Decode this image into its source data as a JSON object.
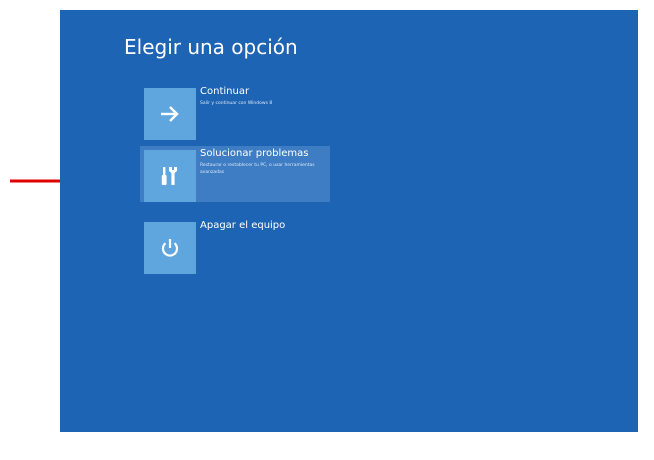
{
  "screen": {
    "title": "Elegir una opción",
    "background_color": "#1e64b4",
    "tile_color": "#5fa6df"
  },
  "options": [
    {
      "label": "Continuar",
      "description": "Salir y continuar con Windows 8",
      "icon": "arrow-right-icon"
    },
    {
      "label": "Solucionar problemas",
      "description": "Restaurar o restablecer tu PC, o usar herramientas avanzadas",
      "icon": "tools-icon",
      "highlighted": true
    },
    {
      "label": "Apagar el equipo",
      "description": "",
      "icon": "power-icon"
    }
  ],
  "annotation": {
    "icon": "red-arrow-icon",
    "color": "#e00000"
  }
}
